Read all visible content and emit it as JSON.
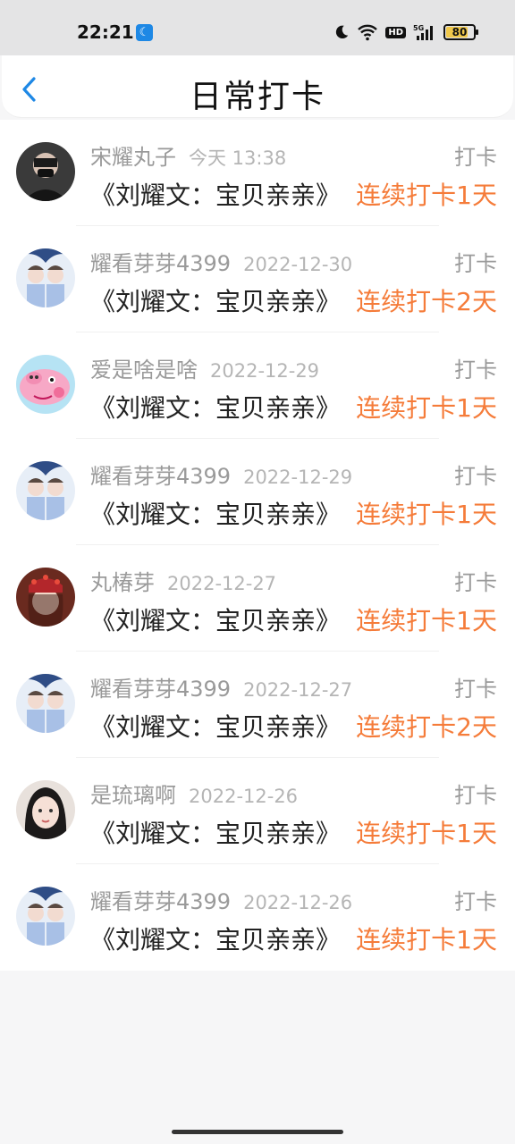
{
  "status_bar": {
    "time": "22:21",
    "battery": "80",
    "network": "5G",
    "hd": "HD"
  },
  "header": {
    "title": "日常打卡"
  },
  "colors": {
    "streak": "#f57c3a",
    "accent_back": "#1e88e5"
  },
  "entries": [
    {
      "name": "宋耀丸子",
      "time": "今天 13:38",
      "action": "打卡",
      "book": "《刘耀文：宝贝亲亲》",
      "streak": "连续打卡1天",
      "avatar": "dark-portrait"
    },
    {
      "name": "耀看芽芽4399",
      "time": "2022-12-30",
      "action": "打卡",
      "book": "《刘耀文：宝贝亲亲》",
      "streak": "连续打卡2天",
      "avatar": "blue-pair"
    },
    {
      "name": "爱是啥是啥",
      "time": "2022-12-29",
      "action": "打卡",
      "book": "《刘耀文：宝贝亲亲》",
      "streak": "连续打卡1天",
      "avatar": "pink-pig"
    },
    {
      "name": "耀看芽芽4399",
      "time": "2022-12-29",
      "action": "打卡",
      "book": "《刘耀文：宝贝亲亲》",
      "streak": "连续打卡1天",
      "avatar": "blue-pair"
    },
    {
      "name": "丸椿芽",
      "time": "2022-12-27",
      "action": "打卡",
      "book": "《刘耀文：宝贝亲亲》",
      "streak": "连续打卡1天",
      "avatar": "red-crown"
    },
    {
      "name": "耀看芽芽4399",
      "time": "2022-12-27",
      "action": "打卡",
      "book": "《刘耀文：宝贝亲亲》",
      "streak": "连续打卡2天",
      "avatar": "blue-pair"
    },
    {
      "name": "是琉璃啊",
      "time": "2022-12-26",
      "action": "打卡",
      "book": "《刘耀文：宝贝亲亲》",
      "streak": "连续打卡1天",
      "avatar": "girl-portrait"
    },
    {
      "name": "耀看芽芽4399",
      "time": "2022-12-26",
      "action": "打卡",
      "book": "《刘耀文：宝贝亲亲》",
      "streak": "连续打卡1天",
      "avatar": "blue-pair"
    }
  ]
}
